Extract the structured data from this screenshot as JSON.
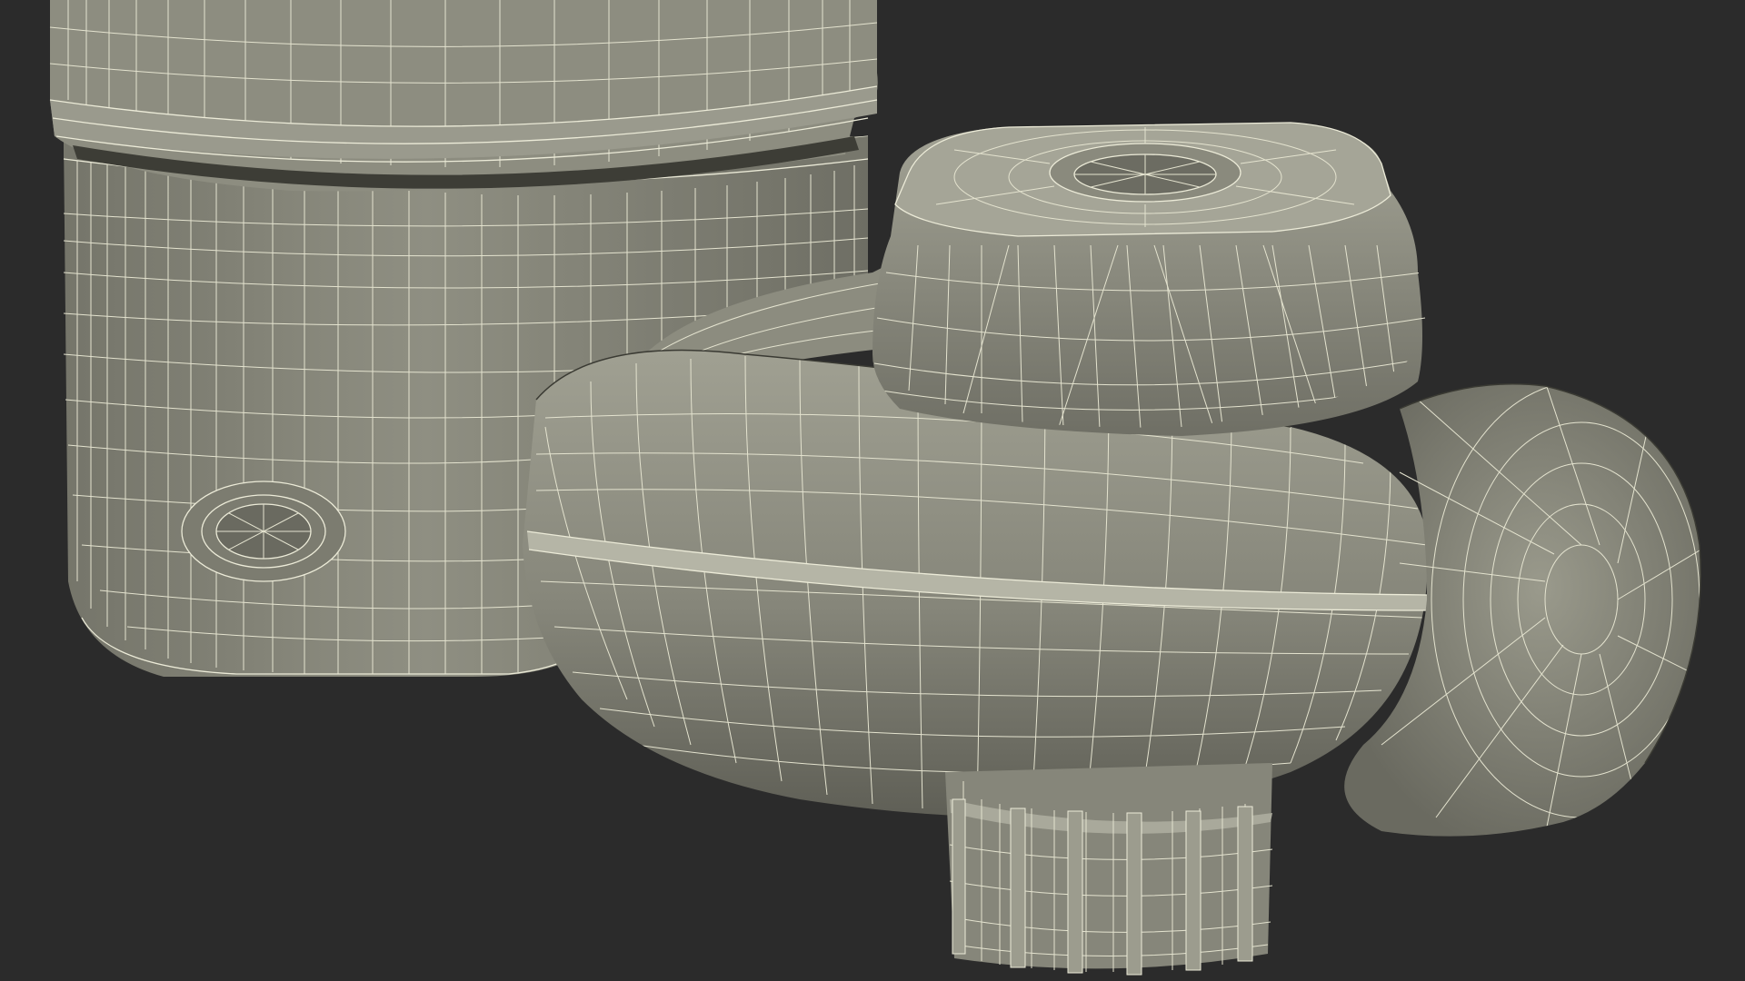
{
  "scene": {
    "subject": "faucet-water-filter-wireframe",
    "colors": {
      "background": "#2b2b2b",
      "surface": "#8a8a7c",
      "surface_dark": "#5e5e54",
      "surface_light": "#9e9e90",
      "wire": "#ecebd8"
    }
  }
}
